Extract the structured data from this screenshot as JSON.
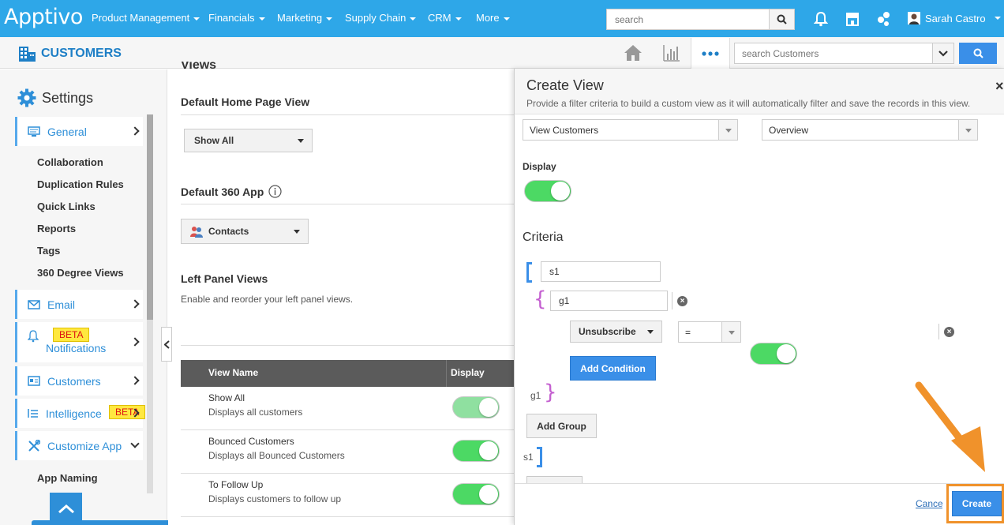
{
  "app": {
    "logo": "Apptivo",
    "title": "CUSTOMERS"
  },
  "topnav": [
    {
      "label": "Product Management"
    },
    {
      "label": "Financials"
    },
    {
      "label": "Marketing"
    },
    {
      "label": "Supply Chain"
    },
    {
      "label": "CRM"
    },
    {
      "label": "More"
    }
  ],
  "global_search": {
    "placeholder": "search"
  },
  "user": {
    "name": "Sarah Castro"
  },
  "subbar": {
    "search_placeholder": "search Customers"
  },
  "sidebar": {
    "title": "Settings",
    "general": {
      "label": "General"
    },
    "general_items": [
      "Collaboration",
      "Duplication Rules",
      "Quick Links",
      "Reports",
      "Tags",
      "360 Degree Views"
    ],
    "email": {
      "label": "Email"
    },
    "notifications": {
      "label": "Notifications",
      "badge": "BETA"
    },
    "customers": {
      "label": "Customers"
    },
    "intelligence": {
      "label": "Intelligence",
      "badge": "BETA"
    },
    "customize": {
      "label": "Customize App"
    },
    "customize_items": [
      "App Naming"
    ]
  },
  "main": {
    "cut_heading": "Views",
    "default_home": {
      "title": "Default Home Page View",
      "value": "Show All"
    },
    "default_360": {
      "title": "Default 360 App",
      "value": "Contacts"
    },
    "left_panel": {
      "title": "Left Panel Views",
      "desc": "Enable and reorder your left panel views."
    },
    "table": {
      "col_name": "View Name",
      "col_display": "Display",
      "rows": [
        {
          "name": "Show All",
          "desc": "Displays all customers",
          "display": true
        },
        {
          "name": "Bounced Customers",
          "desc": "Displays all Bounced Customers",
          "display": true
        },
        {
          "name": "To Follow Up",
          "desc": "Displays customers to follow up",
          "display": true
        }
      ]
    }
  },
  "panel": {
    "title": "Create View",
    "subtitle": "Provide a filter criteria to build a custom view as it will automatically filter and save the records in this view.",
    "view_select": "View Customers",
    "type_select": "Overview",
    "display_label": "Display",
    "display_on": true,
    "criteria_label": "Criteria",
    "s1_value": "s1",
    "g1_value": "g1",
    "condition": {
      "field": "Unsubscribe",
      "operator": "=",
      "value_on": true
    },
    "add_condition": "Add Condition",
    "g1_close": "g1",
    "add_group": "Add Group",
    "s1_close": "s1",
    "cancel": "Cancel",
    "create": "Create"
  },
  "colors": {
    "brand": "#2ea7e8",
    "accent": "#3a8fe8",
    "toggle_on": "#4cd964",
    "highlight": "#f0922b"
  }
}
